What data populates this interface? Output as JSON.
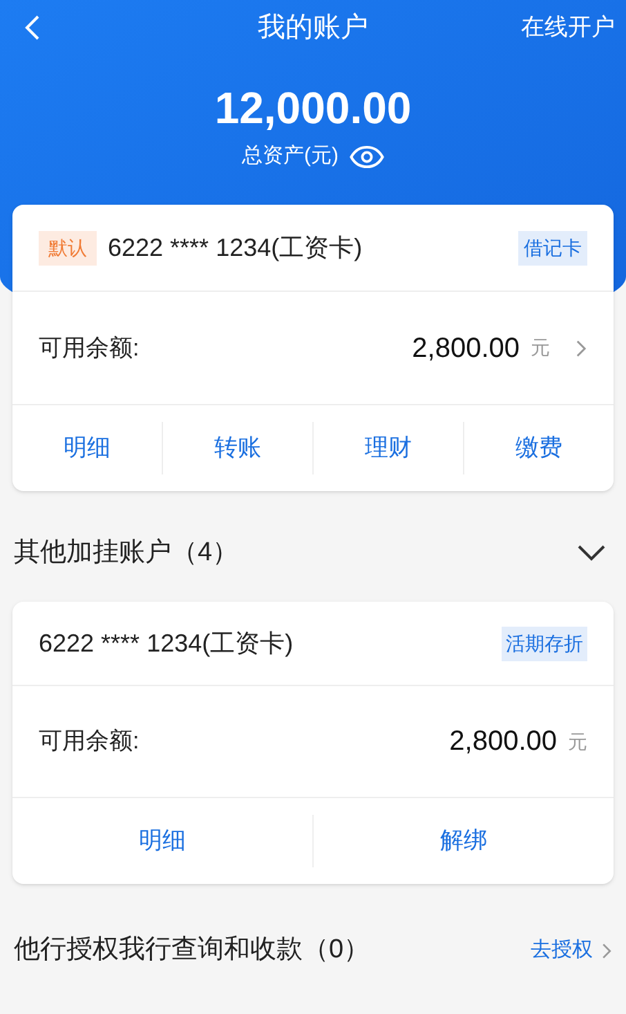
{
  "nav": {
    "title": "我的账户",
    "action": "在线开户"
  },
  "total": {
    "amount": "12,000.00",
    "label": "总资产(元)"
  },
  "main_card": {
    "default_badge": "默认",
    "account": "6222 **** 1234(工资卡)",
    "type_badge": "借记卡",
    "balance_label": "可用余额:",
    "balance": "2,800.00",
    "unit": "元",
    "actions": [
      "明细",
      "转账",
      "理财",
      "缴费"
    ]
  },
  "linked": {
    "title": "其他加挂账户（4）",
    "expanded": true,
    "cards": [
      {
        "account": "6222 **** 1234(工资卡)",
        "type_badge": "活期存折",
        "balance_label": "可用余额:",
        "balance": "2,800.00",
        "unit": "元",
        "actions": [
          "明细",
          "解绑"
        ]
      }
    ]
  },
  "authorize": {
    "title": "他行授权我行查询和收款（0）",
    "link": "去授权"
  }
}
